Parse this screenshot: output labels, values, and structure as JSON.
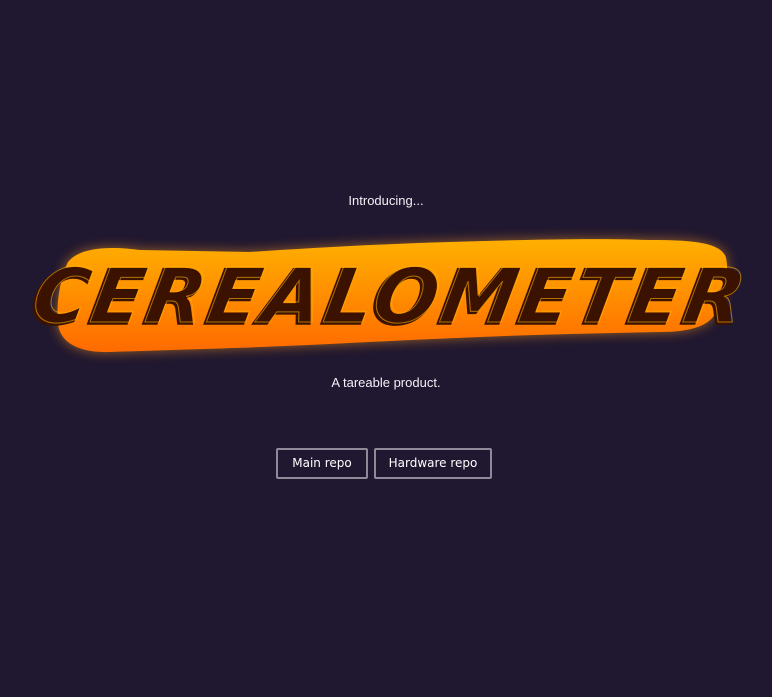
{
  "intro_text": "Introducing...",
  "logo": {
    "text": "CEREALOMETER",
    "fill_colors": [
      "#ffb000",
      "#ff8a00",
      "#ff6a00"
    ],
    "glow_color": "#ff9d1e",
    "letter_color": "#3b1200"
  },
  "tagline": "A tareable product.",
  "buttons": {
    "main_repo": "Main repo",
    "hardware_repo": "Hardware repo"
  },
  "colors": {
    "background": "#201730",
    "button_border": "#8e8a98",
    "text": "#ffffff"
  }
}
